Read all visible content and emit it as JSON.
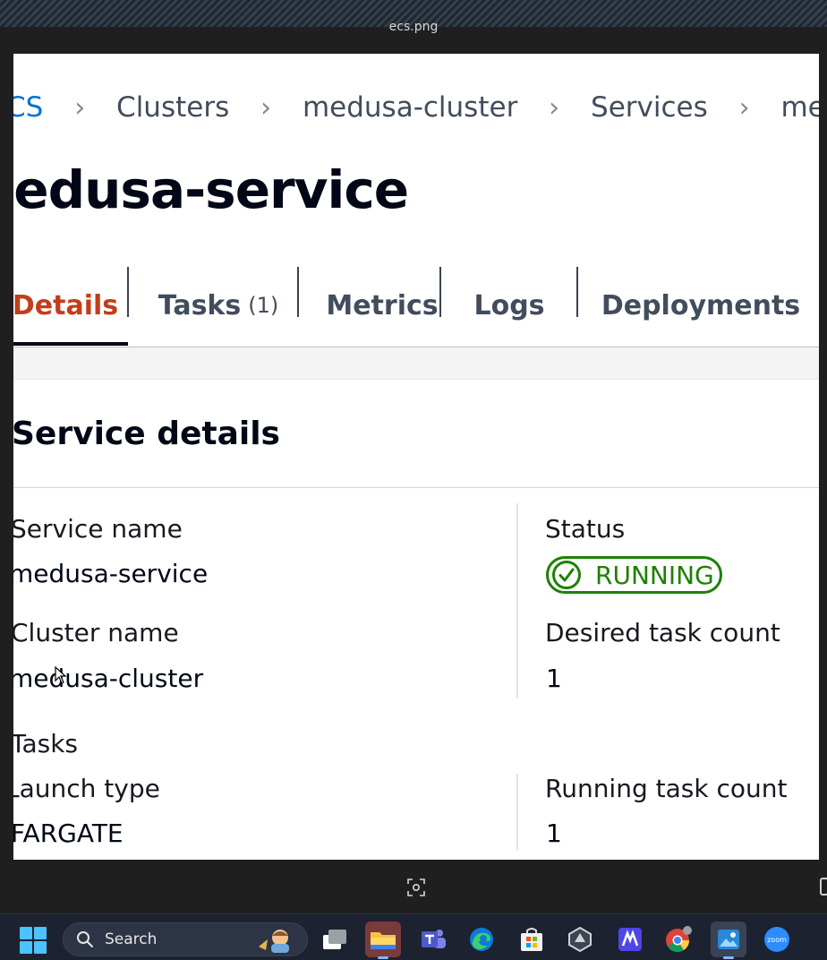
{
  "viewer": {
    "file_name": "ecs.png"
  },
  "breadcrumb": [
    {
      "label": "CS",
      "link": true
    },
    {
      "label": "Clusters",
      "link": false
    },
    {
      "label": "medusa-cluster",
      "link": false
    },
    {
      "label": "Services",
      "link": false
    },
    {
      "label": "medusa-",
      "link": false
    }
  ],
  "page": {
    "title": "nedusa-service"
  },
  "tabs": [
    {
      "label": "Details",
      "count": "",
      "active": true
    },
    {
      "label": "Tasks",
      "count": "(1)",
      "active": false
    },
    {
      "label": "Metrics",
      "count": "",
      "active": false
    },
    {
      "label": "Logs",
      "count": "",
      "active": false
    },
    {
      "label": "Deployments",
      "count": "",
      "active": false
    }
  ],
  "service_details": {
    "title": "Service details",
    "service_name_label": "Service name",
    "service_name_value": "medusa-service",
    "status_label": "Status",
    "status_value": "RUNNING",
    "cluster_name_label": "Cluster name",
    "cluster_name_value": "medusa-cluster",
    "desired_count_label": "Desired task count",
    "desired_count_value": "1",
    "tasks_heading": "Tasks",
    "launch_type_label": "Launch type",
    "launch_type_value": "FARGATE",
    "running_count_label": "Running task count",
    "running_count_value": "1"
  },
  "taskbar": {
    "search_placeholder": "Search"
  },
  "colors": {
    "active_tab": "#c33d1b",
    "status_green": "#1d8102",
    "link_blue": "#0972d3",
    "taskbar_bg": "#1c2230"
  }
}
